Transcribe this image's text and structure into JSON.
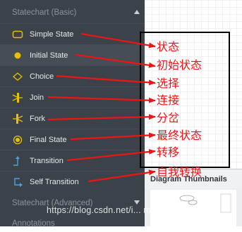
{
  "palette": {
    "section_basic": "Statechart (Basic)",
    "section_advanced": "Statechart (Advanced)",
    "section_annotations": "Annotations",
    "items": [
      {
        "label": "Simple State",
        "icon": "simple-state-icon"
      },
      {
        "label": "Initial State",
        "icon": "initial-state-icon"
      },
      {
        "label": "Choice",
        "icon": "choice-icon"
      },
      {
        "label": "Join",
        "icon": "join-icon"
      },
      {
        "label": "Fork",
        "icon": "fork-icon"
      },
      {
        "label": "Final State",
        "icon": "final-state-icon"
      },
      {
        "label": "Transition",
        "icon": "transition-icon"
      },
      {
        "label": "Self Transition",
        "icon": "self-transition-icon"
      }
    ]
  },
  "thumbnail_panel": {
    "title": "Diagram Thumbnails"
  },
  "annotations": {
    "labels": [
      "状态",
      "初始状态",
      "选择",
      "连接",
      "分岔",
      "最终状态",
      "转移",
      "自我转换"
    ],
    "color": "#f01414"
  },
  "watermark": "https://blog.csdn.net/i... met... shower",
  "colors": {
    "palette_bg": "#3c4249",
    "icon_yellow": "#e7c000",
    "icon_blue": "#4aa3df"
  }
}
